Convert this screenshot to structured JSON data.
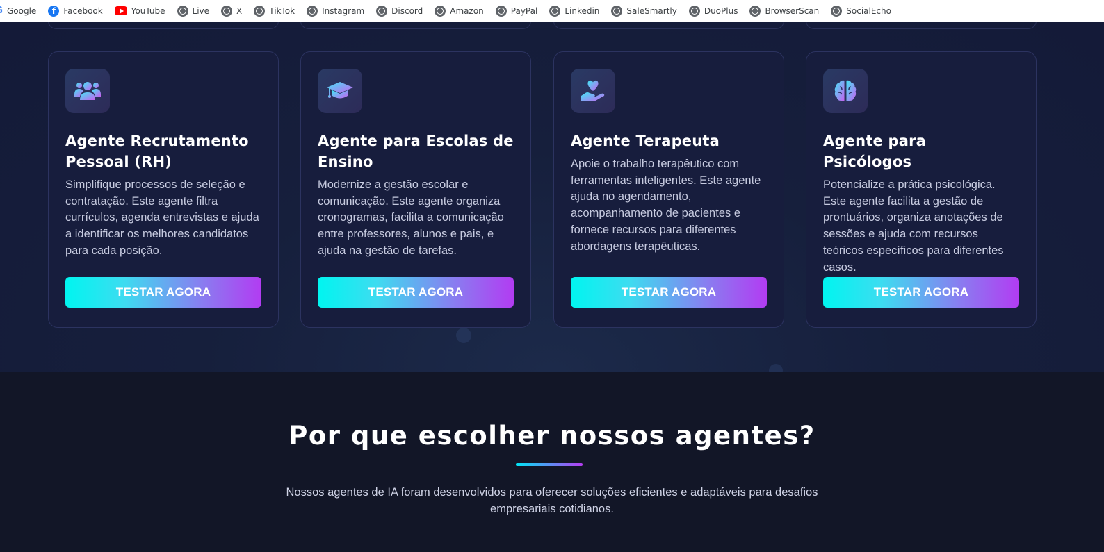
{
  "bookmarks": [
    {
      "label": "Google",
      "icon": "google-icon"
    },
    {
      "label": "Facebook",
      "icon": "facebook-icon"
    },
    {
      "label": "YouTube",
      "icon": "youtube-icon"
    },
    {
      "label": "Live",
      "icon": "globe-icon"
    },
    {
      "label": "X",
      "icon": "globe-icon"
    },
    {
      "label": "TikTok",
      "icon": "globe-icon"
    },
    {
      "label": "Instagram",
      "icon": "globe-icon"
    },
    {
      "label": "Discord",
      "icon": "globe-icon"
    },
    {
      "label": "Amazon",
      "icon": "globe-icon"
    },
    {
      "label": "PayPal",
      "icon": "globe-icon"
    },
    {
      "label": "Linkedin",
      "icon": "globe-icon"
    },
    {
      "label": "SaleSmartly",
      "icon": "globe-icon"
    },
    {
      "label": "DuoPlus",
      "icon": "globe-icon"
    },
    {
      "label": "BrowserScan",
      "icon": "globe-icon"
    },
    {
      "label": "SocialEcho",
      "icon": "globe-icon"
    }
  ],
  "cards": [
    {
      "icon": "users-icon",
      "title": "Agente Recrutamento Pessoal (RH)",
      "description": "Simplifique processos de seleção e contratação. Este agente filtra currículos, agenda entrevistas e ajuda a identificar os melhores candidatos para cada posição.",
      "button": "TESTAR AGORA"
    },
    {
      "icon": "graduation-cap-icon",
      "title": "Agente para Escolas de Ensino",
      "description": "Modernize a gestão escolar e comunicação. Este agente organiza cronogramas, facilita a comunicação entre professores, alunos e pais, e ajuda na gestão de tarefas.",
      "button": "TESTAR AGORA"
    },
    {
      "icon": "hand-holding-heart-icon",
      "title": "Agente Terapeuta",
      "description": "Apoie o trabalho terapêutico com ferramentas inteligentes. Este agente ajuda no agendamento, acompanhamento de pacientes e fornece recursos para diferentes abordagens terapêuticas.",
      "button": "TESTAR AGORA"
    },
    {
      "icon": "brain-icon",
      "title": "Agente para Psicólogos",
      "description": "Potencialize a prática psicológica. Este agente facilita a gestão de prontuários, organiza anotações de sessões e ajuda com recursos teóricos específicos para diferentes casos.",
      "button": "TESTAR AGORA"
    }
  ],
  "why": {
    "title": "Por que escolher nossos agentes?",
    "description": "Nossos agentes de IA foram desenvolvidos para oferecer soluções eficientes e adaptáveis para desafios empresariais cotidianos."
  },
  "colors": {
    "accent_cyan": "#00f5f0",
    "accent_purple": "#b23cf2",
    "card_bg": "#171d3d",
    "section_bg": "#121627"
  }
}
